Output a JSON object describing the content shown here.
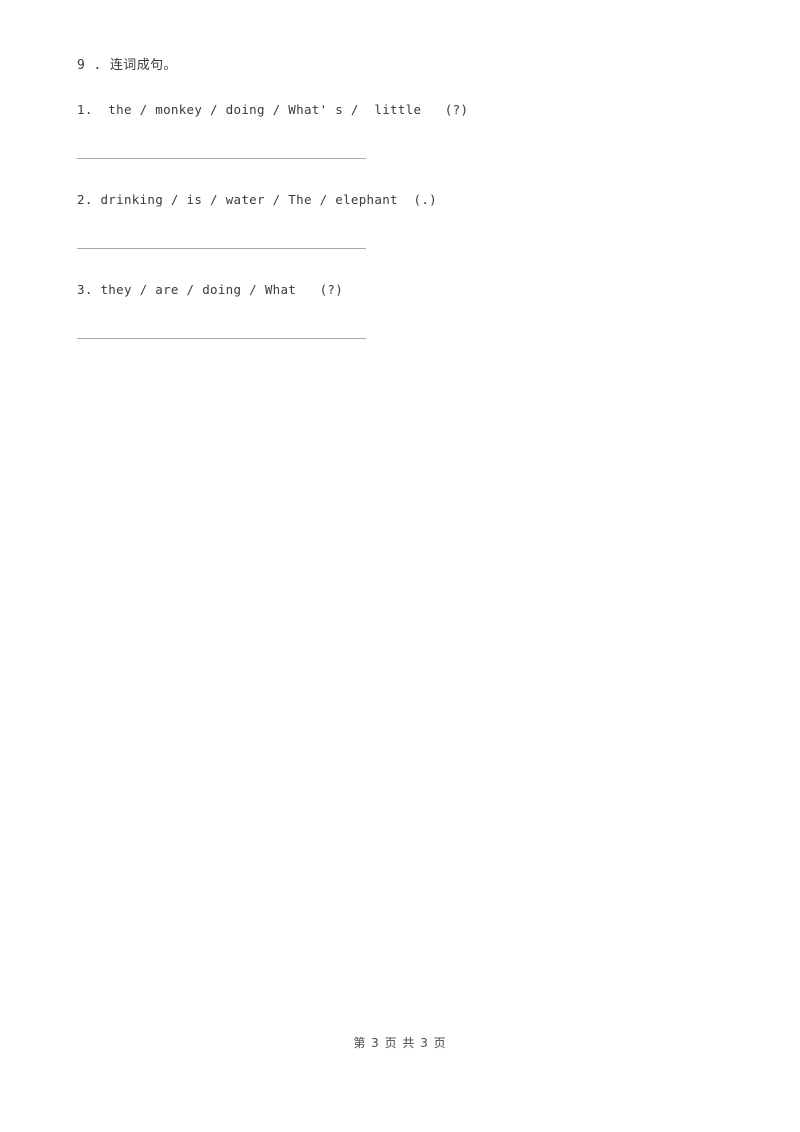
{
  "document": {
    "background_color": "#ffffff",
    "text_color": "#3a3a3a",
    "rule_color": "#a9a9a9"
  },
  "exercise": {
    "heading": "9 . 连词成句。",
    "items": [
      {
        "number": "1.",
        "prompt": "1.  the / monkey / doing / What' s /  little   (?)",
        "answer_value": "",
        "answer_placeholder": ""
      },
      {
        "number": "2.",
        "prompt": "2. drinking / is / water / The / elephant  (.)",
        "answer_value": "",
        "answer_placeholder": ""
      },
      {
        "number": "3.",
        "prompt": "3. they / are / doing / What   (?)",
        "answer_value": "",
        "answer_placeholder": ""
      }
    ]
  },
  "footer": {
    "page_label": "第 3 页 共 3 页",
    "current_page": "3",
    "total_pages": "3"
  }
}
